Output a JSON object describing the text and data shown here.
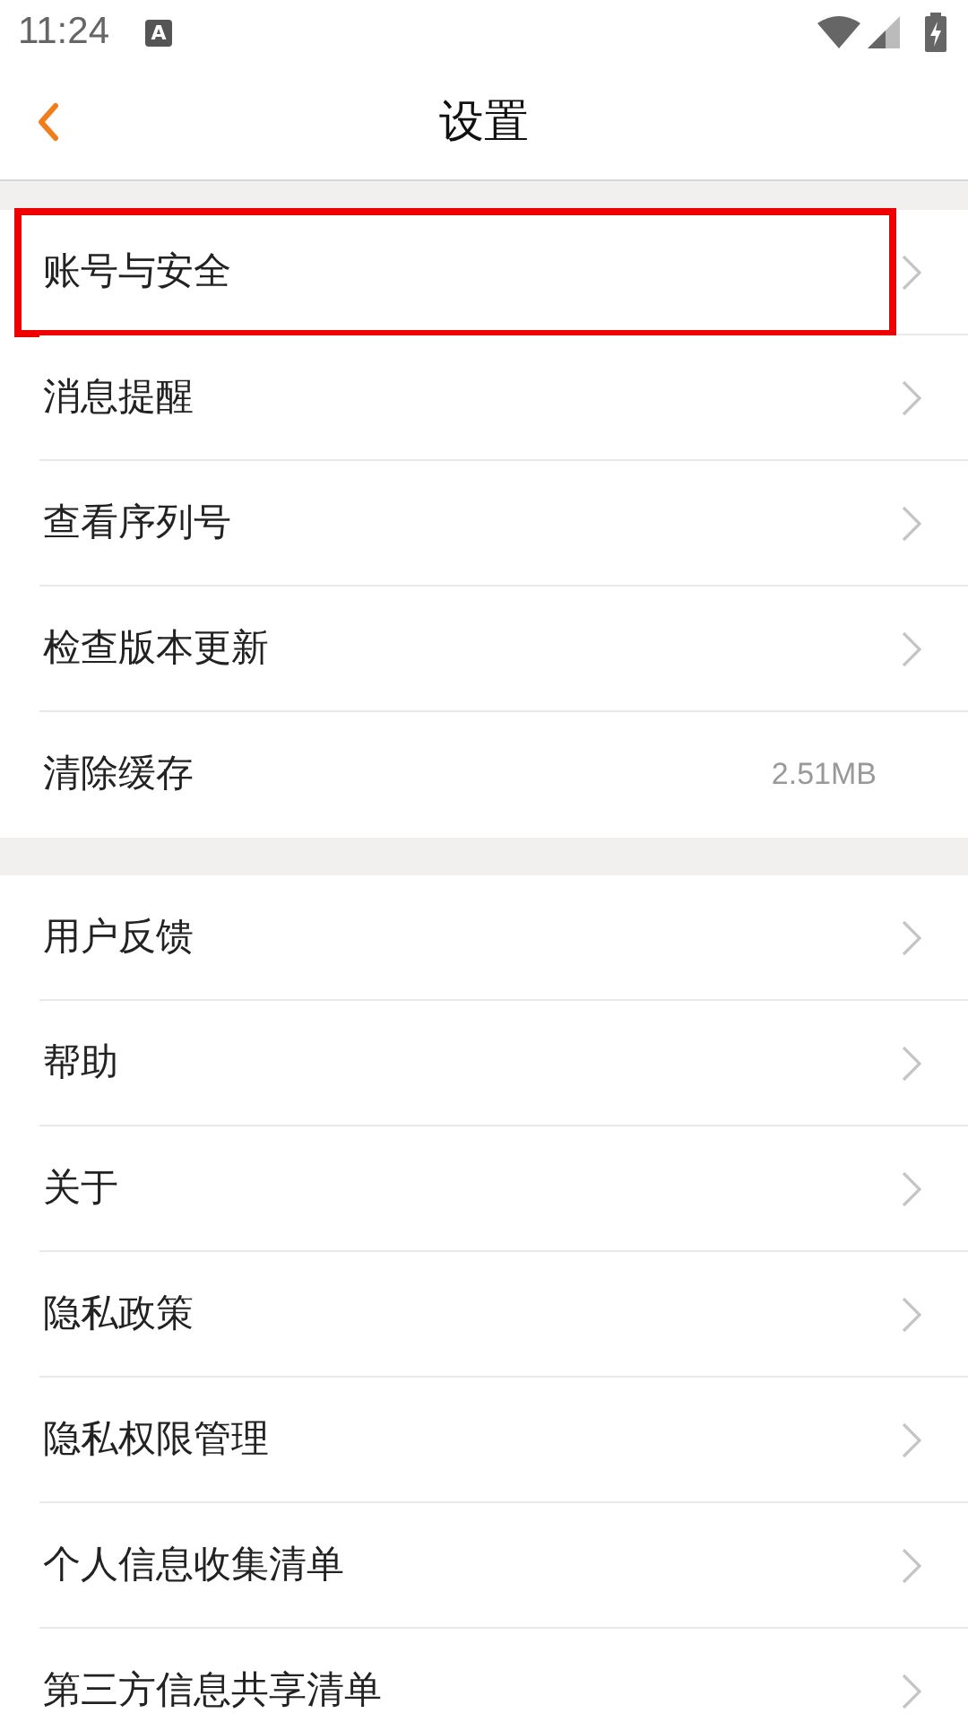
{
  "status_bar": {
    "time": "11:24",
    "notification": "A"
  },
  "header": {
    "title": "设置"
  },
  "groups": [
    {
      "items": [
        {
          "label": "账号与安全",
          "kind": "chevron",
          "highlighted": true
        },
        {
          "label": "消息提醒",
          "kind": "chevron",
          "highlighted": false
        },
        {
          "label": "查看序列号",
          "kind": "chevron",
          "highlighted": false
        },
        {
          "label": "检查版本更新",
          "kind": "chevron",
          "highlighted": false
        },
        {
          "label": "清除缓存",
          "kind": "value",
          "value": "2.51MB",
          "highlighted": false
        }
      ]
    },
    {
      "items": [
        {
          "label": "用户反馈",
          "kind": "chevron",
          "highlighted": false
        },
        {
          "label": "帮助",
          "kind": "chevron",
          "highlighted": false
        },
        {
          "label": "关于",
          "kind": "chevron",
          "highlighted": false
        },
        {
          "label": "隐私政策",
          "kind": "chevron",
          "highlighted": false
        },
        {
          "label": "隐私权限管理",
          "kind": "chevron",
          "highlighted": false
        },
        {
          "label": "个人信息收集清单",
          "kind": "chevron",
          "highlighted": false
        },
        {
          "label": "第三方信息共享清单",
          "kind": "chevron",
          "highlighted": false
        }
      ]
    }
  ]
}
